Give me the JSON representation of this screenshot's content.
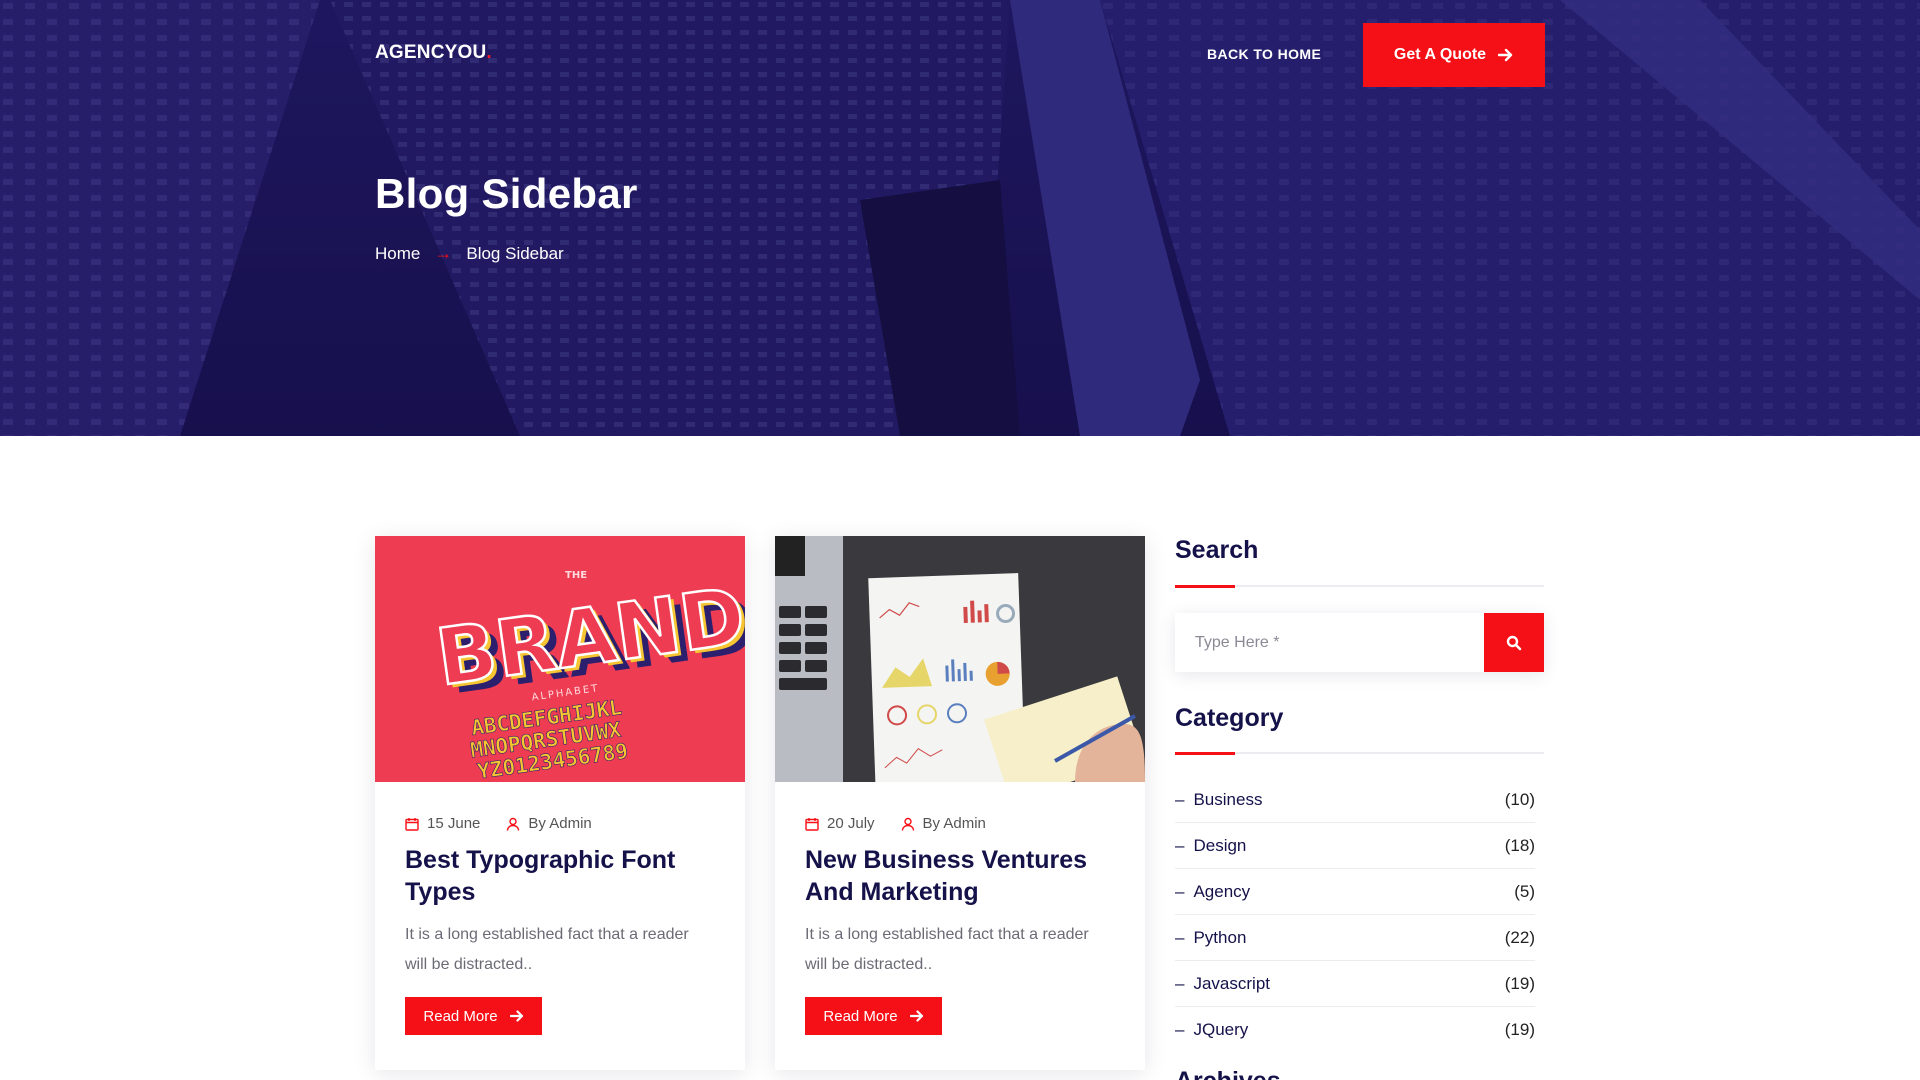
{
  "header": {
    "logo_text": "AGENCYOU",
    "logo_dot": ".",
    "back_home_label": "BACK TO HOME",
    "quote_label": "Get A Quote"
  },
  "hero": {
    "title": "Blog Sidebar",
    "breadcrumb": {
      "home": "Home",
      "separator": "→",
      "current": "Blog Sidebar"
    }
  },
  "posts": [
    {
      "date": "15 June",
      "author": "By Admin",
      "title": "Best Typographic Font Types",
      "excerpt": "It is a long established fact that a reader will be distracted..",
      "read_more": "Read More",
      "image": {
        "brand_word": "BRAND",
        "the_word": "THE",
        "alphabet_word": "ALPHABET",
        "line1": "ABCDEFGHIJKL",
        "line2": "MNOPQRSTUVWX",
        "line3": "YZ0123456789"
      }
    },
    {
      "date": "20 July",
      "author": "By Admin",
      "title": "New Business Ventures And Marketing",
      "excerpt": "It is a long established fact that a reader will be distracted..",
      "read_more": "Read More"
    }
  ],
  "sidebar": {
    "search": {
      "title": "Search",
      "placeholder": "Type Here *"
    },
    "category": {
      "title": "Category",
      "items": [
        {
          "label": "Business",
          "count": "(10)"
        },
        {
          "label": "Design",
          "count": "(18)"
        },
        {
          "label": "Agency",
          "count": "(5)"
        },
        {
          "label": "Python",
          "count": "(22)"
        },
        {
          "label": "Javascript",
          "count": "(19)"
        },
        {
          "label": "JQuery",
          "count": "(19)"
        }
      ]
    },
    "next_widget_title": "Archives"
  },
  "colors": {
    "accent": "#f50f16",
    "hero_overlay": "#1b1457",
    "heading": "#15124a",
    "brand_card_bg": "#ee3c52"
  },
  "icons": {
    "quote_arrow": "arrow-right-icon",
    "date": "calendar-icon",
    "author": "user-icon",
    "search": "search-icon"
  }
}
